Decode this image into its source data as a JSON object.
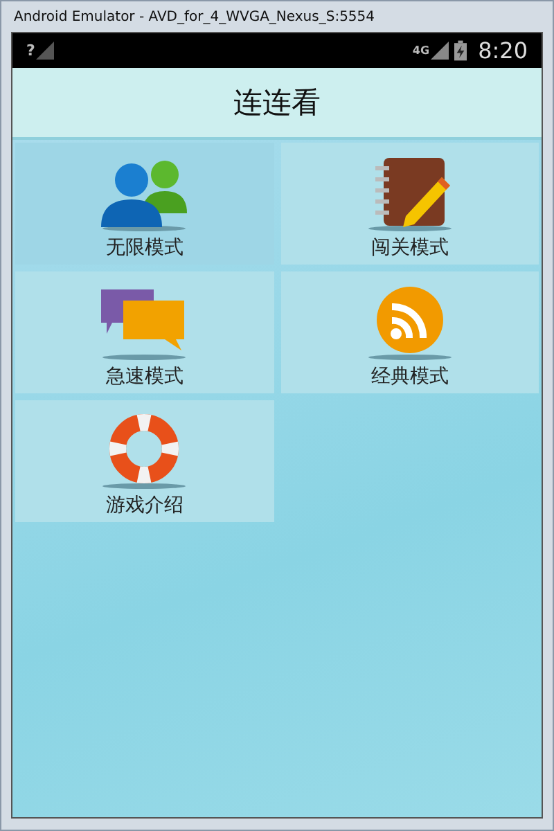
{
  "window": {
    "title": "Android Emulator - AVD_for_4_WVGA_Nexus_S:5554"
  },
  "status_bar": {
    "sim_mark": "?",
    "network": "4G",
    "time": "8:20"
  },
  "app_bar": {
    "title": "连连看"
  },
  "menu": [
    {
      "label": "无限模式",
      "kind": "people",
      "selected": true
    },
    {
      "label": "闯关模式",
      "kind": "notebook",
      "selected": false
    },
    {
      "label": "急速模式",
      "kind": "chat",
      "selected": false
    },
    {
      "label": "经典模式",
      "kind": "rss",
      "selected": false
    },
    {
      "label": "游戏介绍",
      "kind": "lifebuoy",
      "selected": false
    }
  ]
}
